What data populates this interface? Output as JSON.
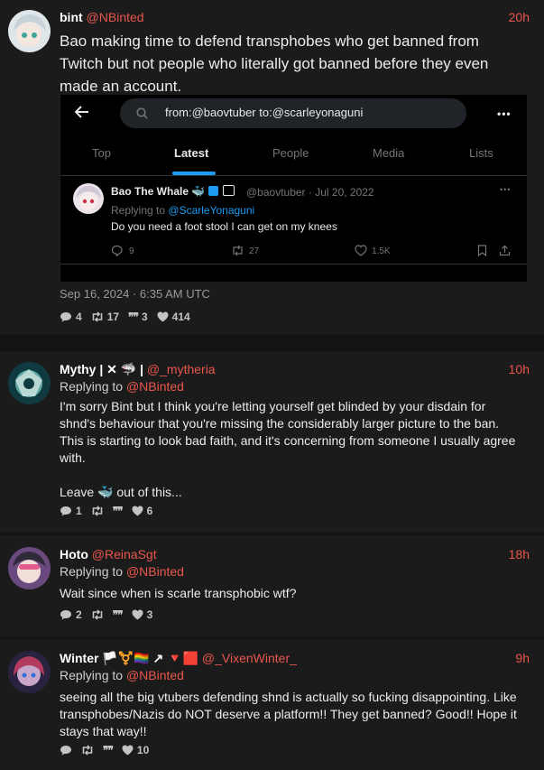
{
  "colors": {
    "background": "#1b1b1b",
    "accent_handle": "#e8564d",
    "twitter_blue": "#1d9bf0"
  },
  "posts": [
    {
      "name": "bint",
      "handle": "@NBinted",
      "time": "20h",
      "text": "Bao making time to defend transphobes who get banned from Twitch but not people who literally got banned before they even made an account.",
      "date": "Sep 16, 2024 · 6:35 AM UTC",
      "stats": {
        "replies": "4",
        "reposts": "17",
        "quotes": "3",
        "likes": "414"
      }
    },
    {
      "name": "Mythy | ✕ 🦈 |",
      "handle": "@_mytheria",
      "time": "10h",
      "replying_label": "Replying to",
      "replying_to": "@NBinted",
      "text": "I'm sorry Bint but I think you're letting yourself get blinded by your disdain for shnd's behaviour that you're missing the considerably larger picture to the ban. This is starting to look bad faith, and it's concerning from someone I usually agree with.\n\nLeave 🐳 out of this...",
      "stats": {
        "replies": "1",
        "reposts": "",
        "quotes": "",
        "likes": "6"
      }
    },
    {
      "name": "Hoto",
      "handle": "@ReinaSgt",
      "time": "18h",
      "replying_label": "Replying to",
      "replying_to": "@NBinted",
      "text": "Wait since when is scarle transphobic wtf?",
      "stats": {
        "replies": "2",
        "reposts": "",
        "quotes": "",
        "likes": "3"
      }
    },
    {
      "name": "Winter 🏳️⚧️🏳️‍🌈 ↗ 🔻🟥",
      "handle": "@_VixenWinter_",
      "time": "9h",
      "replying_label": "Replying to",
      "replying_to": "@NBinted",
      "text": "seeing all the big vtubers defending shnd is actually so fucking disappointing. Like transphobes/Nazis do NOT deserve a platform!! They get banned? Good!! Hope it stays that way!!",
      "stats": {
        "replies": "",
        "reposts": "",
        "quotes": "",
        "likes": "10"
      }
    }
  ],
  "embed": {
    "search_query": "from:@baovtuber to:@scarleyonaguni",
    "tabs": [
      "Top",
      "Latest",
      "People",
      "Media",
      "Lists"
    ],
    "active_tab": "Latest",
    "tweet": {
      "name": "Bao The Whale 🐳",
      "meta": "@baovtuber · Jul 20, 2022",
      "replying_label": "Replying to",
      "replying_to": "@ScarleYonaguni",
      "text": "Do you need a foot stool I can get on my knees",
      "replies": "9",
      "retweets": "27",
      "likes": "1.5K"
    }
  }
}
